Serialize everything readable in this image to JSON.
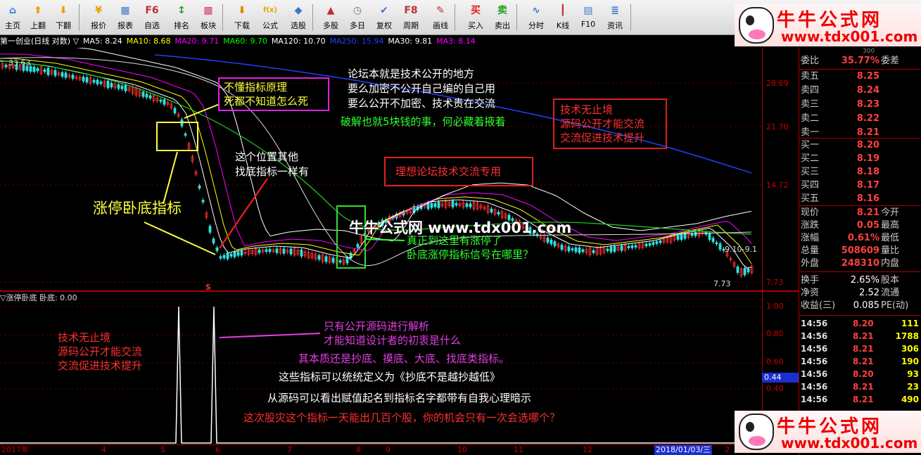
{
  "toolbar": {
    "buttons": [
      {
        "label": "主页",
        "icon": "home-icon",
        "glyph": "⌂",
        "color": "#2a7de1"
      },
      {
        "label": "上翻",
        "icon": "arrow-up-icon",
        "glyph": "⬆",
        "color": "#f0a000"
      },
      {
        "label": "下翻",
        "icon": "arrow-down-icon",
        "glyph": "⬇",
        "color": "#f0a000"
      },
      {
        "label": "报价",
        "icon": "yen-icon",
        "glyph": "¥",
        "color": "#e8a000"
      },
      {
        "label": "报表",
        "icon": "report-icon",
        "glyph": "▦",
        "color": "#3a78c8"
      },
      {
        "label": "自选",
        "icon": "f6-icon",
        "glyph": "F6",
        "color": "#c03030"
      },
      {
        "label": "排名",
        "icon": "rank-icon",
        "glyph": "↕",
        "color": "#2a9a2a"
      },
      {
        "label": "板块",
        "icon": "sector-icon",
        "glyph": "▩",
        "color": "#d04080"
      },
      {
        "label": "下载",
        "icon": "download-icon",
        "glyph": "⬇",
        "color": "#e08000"
      },
      {
        "label": "公式",
        "icon": "formula-icon",
        "glyph": "f(x)",
        "color": "#e8a000"
      },
      {
        "label": "选股",
        "icon": "stock-pick-icon",
        "glyph": "◆",
        "color": "#3a78c8"
      },
      {
        "label": "多股",
        "icon": "multi-stock-icon",
        "glyph": "▲",
        "color": "#c03030"
      },
      {
        "label": "多日",
        "icon": "clock-icon",
        "glyph": "◷",
        "color": "#777777"
      },
      {
        "label": "复权",
        "icon": "restore-rights-icon",
        "glyph": "✔",
        "color": "#3a78c8"
      },
      {
        "label": "周期",
        "icon": "f8-icon",
        "glyph": "F8",
        "color": "#c03030"
      },
      {
        "label": "画线",
        "icon": "draw-line-icon",
        "glyph": "✎",
        "color": "#c03030"
      },
      {
        "label": "买入",
        "icon": "buy-icon",
        "glyph": "买",
        "color": "#e02020"
      },
      {
        "label": "卖出",
        "icon": "sell-icon",
        "glyph": "卖",
        "color": "#20a020"
      },
      {
        "label": "分时",
        "icon": "intraday-icon",
        "glyph": "∿",
        "color": "#3a78c8"
      },
      {
        "label": "K线",
        "icon": "kline-icon",
        "glyph": "┃",
        "color": "#c03030"
      },
      {
        "label": "F10",
        "icon": "f10-icon",
        "glyph": "▤",
        "color": "#3a78c8"
      },
      {
        "label": "资讯",
        "icon": "news-icon",
        "glyph": "≣",
        "color": "#3a78c8"
      }
    ]
  },
  "infobar": {
    "title": "第一创业(日线 对数) ▽",
    "mas": [
      {
        "text": "MA5: 8.24",
        "color": "#ffffff"
      },
      {
        "text": "MA10: 8.68",
        "color": "#ffff00"
      },
      {
        "text": "MA20: 9.71",
        "color": "#ff00ff"
      },
      {
        "text": "MA60: 9.70",
        "color": "#00ff00"
      },
      {
        "text": "MA120: 10.70",
        "color": "#ffffff"
      },
      {
        "text": "MA250: 15.94",
        "color": "#2040ff"
      },
      {
        "text": "MA30: 9.81",
        "color": "#ffffff"
      },
      {
        "text": "MA3: 8.14",
        "color": "#ff00ff"
      }
    ]
  },
  "main_chart": {
    "y_ticks": [
      "28.69",
      "21.70",
      "14.72",
      "7.73"
    ],
    "high_label": "33.63",
    "low_label": "7.73",
    "right_label": "9.10-9.1",
    "marker": "S"
  },
  "lower_chart": {
    "title": "▽涨停卧底 卧底: 0.00",
    "y_ticks": [
      "1.00",
      "0.80",
      "0.60",
      "0.40"
    ],
    "current": "0.44"
  },
  "datebar": {
    "labels": [
      "2017年",
      "4",
      "5",
      "6",
      "7",
      "8",
      "9",
      "10",
      "11",
      "12",
      "2018/01/03/三",
      "2"
    ]
  },
  "annotations": {
    "forum_line1": "论坛本就是技术公开的地方",
    "forum_line2": "要么加密不公开自己编的自己用",
    "forum_line3": "要么公开不加密、技术贵在交流",
    "crack": "破解也就5块钱的事，何必藏着掖着",
    "box_left_1": "不懂指标原理",
    "box_left_2": "死都不知道怎么死",
    "right_box_1": "技术无止境",
    "right_box_2": "源码公开才能交流",
    "right_box_3": "交流促进技术提升",
    "forum_exclusive": "理想论坛技术交流专用",
    "position_1": "这个位置其他",
    "position_2": "找底指标一样有",
    "indicator_name": "涨停卧底指标",
    "watermark_mid": "牛牛公式网 www.tdx001.com",
    "limitup_1": "真正到这里有涨停了",
    "limitup_2": "卧底涨停指标信号在哪里？",
    "low_left_1": "技术无止境",
    "low_left_2": "源码公开才能交流",
    "low_left_3": "交流促进技术提升",
    "low_mag_1": "只有公开源码进行解析",
    "low_mag_2": "才能知道设计者的初衷是什么",
    "low_1": "其本质还是抄底、摸底、大底、找底类指标。",
    "low_2": "这些指标可以统统定义为《抄底不是越抄越低》",
    "low_3": "从源码可以看出赋值起名到指标名字都带有自我心理暗示",
    "low_4": "这次股灾这个指标一天能出几百个股，你的机会只有一次会选哪个？"
  },
  "watermark": {
    "name": "牛牛公式网",
    "url": "www.tdx001.com"
  },
  "quote_panel": {
    "top_partial": "300",
    "weibi_label": "委比",
    "weibi_value": "35.77%",
    "weicha_label": "委差",
    "asks": [
      {
        "label": "卖五",
        "price": "8.25"
      },
      {
        "label": "卖四",
        "price": "8.24"
      },
      {
        "label": "卖三",
        "price": "8.23"
      },
      {
        "label": "卖二",
        "price": "8.22"
      },
      {
        "label": "卖一",
        "price": "8.21"
      }
    ],
    "bids": [
      {
        "label": "买一",
        "price": "8.20"
      },
      {
        "label": "买二",
        "price": "8.19"
      },
      {
        "label": "买三",
        "price": "8.18"
      },
      {
        "label": "买四",
        "price": "8.17"
      },
      {
        "label": "买五",
        "price": "8.16"
      }
    ],
    "stats": [
      {
        "k": "现价",
        "v": "8.21",
        "k2": "今开"
      },
      {
        "k": "涨跌",
        "v": "0.05",
        "k2": "最高"
      },
      {
        "k": "涨幅",
        "v": "0.61%",
        "k2": "最低"
      },
      {
        "k": "总量",
        "v": "508609",
        "k2": "量比"
      },
      {
        "k": "外盘",
        "v": "248310",
        "k2": "内盘"
      }
    ],
    "stats2": [
      {
        "k": "换手",
        "v": "2.65%",
        "k2": "股本"
      },
      {
        "k": "净资",
        "v": "2.52",
        "k2": "流通"
      },
      {
        "k": "收益(三)",
        "v": "0.085",
        "k2": "PE(动)"
      }
    ],
    "ticks": [
      {
        "t": "14:56",
        "p": "8.20",
        "n": "111"
      },
      {
        "t": "14:56",
        "p": "8.21",
        "n": "1788"
      },
      {
        "t": "14:56",
        "p": "8.21",
        "n": "306"
      },
      {
        "t": "14:56",
        "p": "8.21",
        "n": "190"
      },
      {
        "t": "14:56",
        "p": "8.20",
        "n": "93"
      },
      {
        "t": "14:56",
        "p": "8.21",
        "n": "23"
      },
      {
        "t": "14:56",
        "p": "8.21",
        "n": "490"
      }
    ]
  }
}
